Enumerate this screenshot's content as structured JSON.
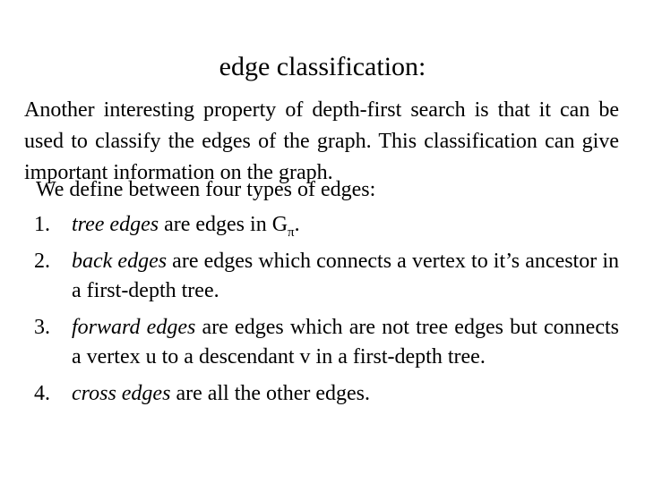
{
  "slide": {
    "title": "edge classification:",
    "intro_paragraph": "Another interesting property of depth-first search is that it can be used to classify the edges of the graph.  This classification can give important information on the graph.",
    "definitions_lead": "We define between four types of edges:",
    "items": [
      {
        "marker": "1.",
        "term": "tree edges",
        "rest_before_symbol": " are edges in G",
        "symbol_subscript": "π",
        "rest_after_symbol": ".",
        "full_text": "tree edges are edges in Gπ."
      },
      {
        "marker": "2.",
        "term": "back edges",
        "rest": " are edges which connects a vertex to it’s ancestor in a first-depth tree.",
        "full_text": "back edges are edges which connects a vertex to it’s ancestor in a first-depth tree."
      },
      {
        "marker": "3.",
        "term": "forward edges",
        "rest": " are edges which are not tree edges but connects a vertex u to a descendant v in a first-depth tree.",
        "full_text": "forward edges are edges which are not tree edges but connects a vertex u to a descendant v in a first-depth tree."
      },
      {
        "marker": "4.",
        "term": "cross edges",
        "rest": " are all the other edges.",
        "full_text": "cross edges are all the other edges."
      }
    ]
  },
  "colors": {
    "background": "#ffffff",
    "text": "#000000"
  }
}
